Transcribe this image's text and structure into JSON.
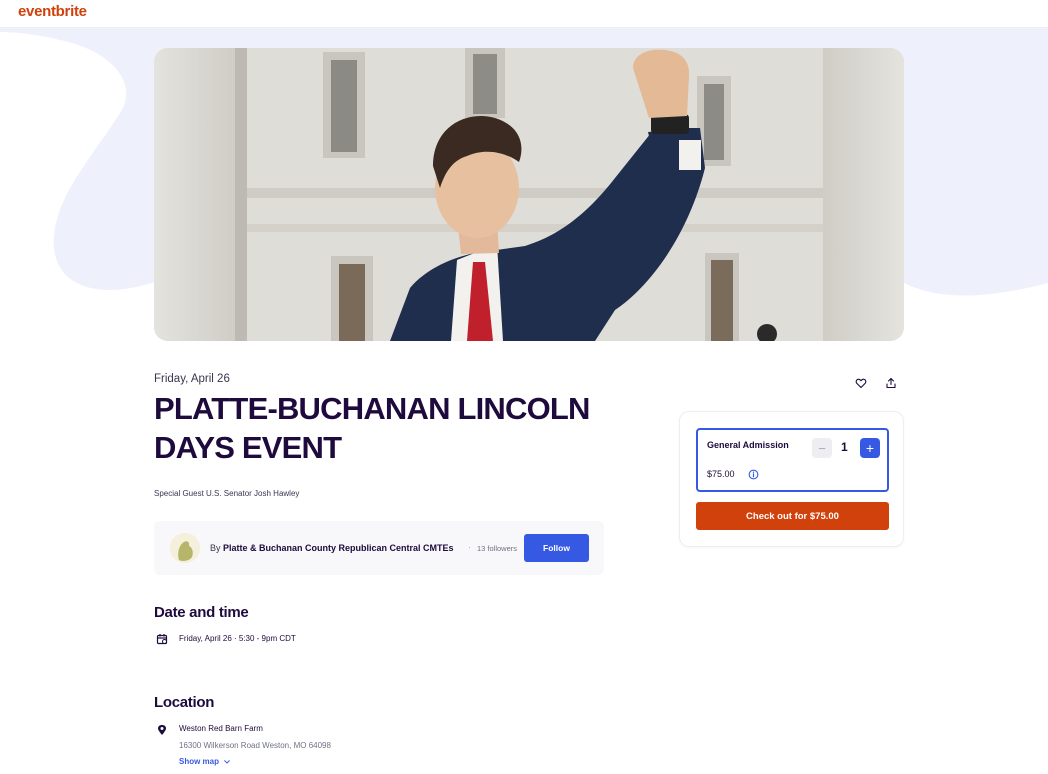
{
  "brand": {
    "logo_text": "eventbrite",
    "accent": "#d1410c",
    "link": "#3659e3",
    "ink": "#1e0a3c"
  },
  "event": {
    "date_short": "Friday, April 26",
    "title": "PLATTE-BUCHANAN LINCOLN DAYS EVENT",
    "summary": "Special Guest U.S. Senator Josh Hawley",
    "hero_image": "senator-raised-fist-photo"
  },
  "actions": {
    "like_icon": "heart-icon",
    "share_icon": "share-icon"
  },
  "organizer": {
    "by_prefix": "By",
    "name": "Platte & Buchanan County Republican Central CMTEs",
    "separator": "·",
    "followers": "13 followers",
    "follow_label": "Follow"
  },
  "date_time": {
    "heading": "Date and time",
    "icon": "calendar-icon",
    "value": "Friday, April 26 · 5:30 - 9pm CDT"
  },
  "location": {
    "heading": "Location",
    "icon": "map-pin-icon",
    "venue": "Weston Red Barn Farm",
    "address": "16300 Wilkerson Road Weston, MO 64098",
    "show_map_label": "Show map"
  },
  "ticket": {
    "name": "General Admission",
    "minus_symbol": "−",
    "quantity": "1",
    "plus_symbol": "+",
    "price": "$75.00",
    "checkout_label": "Check out for $75.00"
  }
}
